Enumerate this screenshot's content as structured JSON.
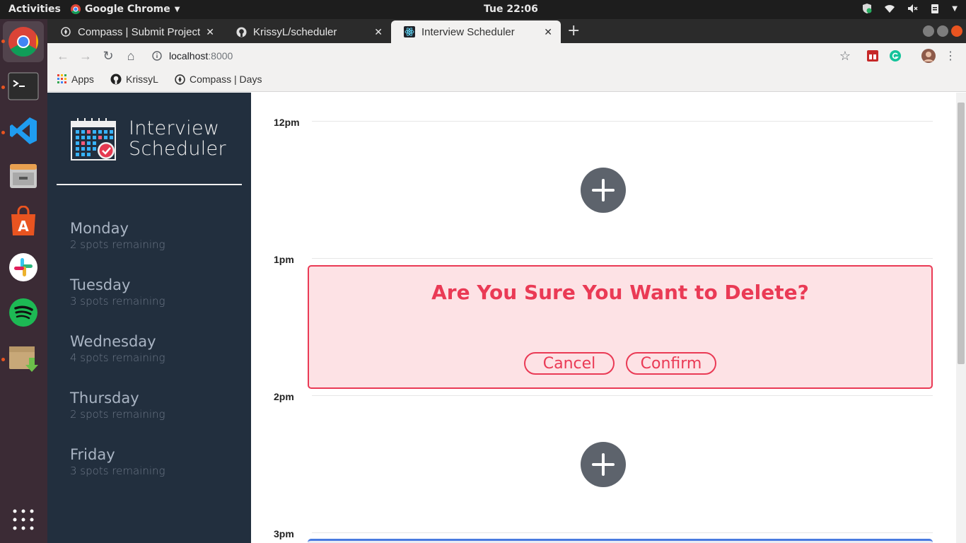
{
  "os": {
    "activities": "Activities",
    "app_menu": "Google Chrome",
    "clock": "Tue 22:06"
  },
  "browser": {
    "tabs": [
      {
        "title": "Compass | Submit Project"
      },
      {
        "title": "KrissyL/scheduler"
      },
      {
        "title": "Interview Scheduler"
      }
    ],
    "url_host": "localhost",
    "url_port": ":8000",
    "bookmarks": [
      "Apps",
      "KrissyL",
      "Compass | Days"
    ]
  },
  "app": {
    "brand_line1": "Interview",
    "brand_line2": "Scheduler",
    "days": [
      {
        "name": "Monday",
        "spots": "2 spots remaining"
      },
      {
        "name": "Tuesday",
        "spots": "3 spots remaining"
      },
      {
        "name": "Wednesday",
        "spots": "4 spots remaining"
      },
      {
        "name": "Thursday",
        "spots": "2 spots remaining"
      },
      {
        "name": "Friday",
        "spots": "3 spots remaining"
      }
    ],
    "times": [
      "12pm",
      "1pm",
      "2pm",
      "3pm"
    ],
    "confirm": {
      "message": "Are You Sure You Want to Delete?",
      "cancel": "Cancel",
      "confirm": "Confirm"
    }
  },
  "colors": {
    "sidebar_bg": "#222f3e",
    "danger": "#ea3a55",
    "danger_bg": "#fde2e5",
    "add_button": "#5d636c"
  }
}
